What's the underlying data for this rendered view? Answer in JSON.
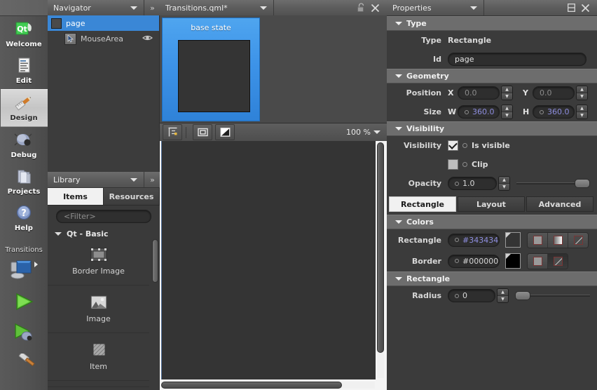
{
  "modebar": {
    "items": [
      {
        "label": "Welcome",
        "icon": "qt-logo-icon",
        "selected": false
      },
      {
        "label": "Edit",
        "icon": "document-edit-icon",
        "selected": false
      },
      {
        "label": "Design",
        "icon": "pencil-ruler-icon",
        "selected": true
      },
      {
        "label": "Debug",
        "icon": "bug-icon",
        "selected": false
      },
      {
        "label": "Projects",
        "icon": "folders-icon",
        "selected": false
      },
      {
        "label": "Help",
        "icon": "question-mark-icon",
        "selected": false
      }
    ],
    "target_label": "Transitions",
    "run_buttons": [
      {
        "name": "target-selector-icon"
      },
      {
        "name": "run-icon"
      },
      {
        "name": "debug-run-icon"
      },
      {
        "name": "build-hammer-icon"
      }
    ]
  },
  "navigator": {
    "title": "Navigator",
    "expand_label": "»",
    "rows": [
      {
        "label": "page",
        "selected": true,
        "has_eye": false,
        "icon": "rectangle-icon"
      },
      {
        "label": "MouseArea",
        "selected": false,
        "has_eye": true,
        "icon": "mousearea-cursor-icon"
      }
    ]
  },
  "library": {
    "title": "Library",
    "expand_label": "»",
    "tabs": [
      {
        "label": "Items",
        "active": true
      },
      {
        "label": "Resources",
        "active": false
      }
    ],
    "filter_placeholder": "<Filter>",
    "group": "Qt - Basic",
    "items": [
      {
        "label": "Border Image",
        "icon": "border-image-icon"
      },
      {
        "label": "Image",
        "icon": "image-icon"
      },
      {
        "label": "Item",
        "icon": "item-icon"
      }
    ]
  },
  "form_editor": {
    "document_title": "Transitions.qml*",
    "lock_icon": "unlocked-icon",
    "close_icon": "close-icon",
    "state_card": {
      "label": "base state"
    },
    "toolbar": {
      "buttons": [
        {
          "name": "anchors-icon"
        },
        {
          "name": "snap-to-item-icon"
        },
        {
          "name": "show-boundaries-icon"
        }
      ],
      "zoom_value": "100 %"
    }
  },
  "properties": {
    "title": "Properties",
    "split_icon": "split-icon",
    "close_icon": "close-icon",
    "sections": {
      "type": {
        "header": "Type",
        "type_label": "Type",
        "type_value": "Rectangle",
        "id_label": "Id",
        "id_value": "page"
      },
      "geometry": {
        "header": "Geometry",
        "position_label": "Position",
        "x_label": "X",
        "x_value": "0.0",
        "y_label": "Y",
        "y_value": "0.0",
        "size_label": "Size",
        "w_label": "W",
        "w_value": "360.0",
        "h_label": "H",
        "h_value": "360.0"
      },
      "visibility": {
        "header": "Visibility",
        "visibility_label": "Visibility",
        "is_visible_label": "Is visible",
        "is_visible_checked": true,
        "clip_label": "Clip",
        "clip_checked": false,
        "opacity_label": "Opacity",
        "opacity_value": "1.0"
      },
      "tabs": [
        {
          "label": "Rectangle",
          "active": true
        },
        {
          "label": "Layout",
          "active": false
        },
        {
          "label": "Advanced",
          "active": false
        }
      ],
      "colors": {
        "header": "Colors",
        "rectangle_label": "Rectangle",
        "rectangle_value": "#343434",
        "border_label": "Border",
        "border_value": "#000000",
        "fill_modes": [
          "solid-fill-icon",
          "gradient-fill-icon",
          "no-fill-icon"
        ],
        "border_modes": [
          "solid-fill-icon",
          "no-fill-icon"
        ]
      },
      "rectangle": {
        "header": "Rectangle",
        "radius_label": "Radius",
        "radius_value": "0"
      }
    }
  },
  "colors": {
    "selection_blue": "#3a87d6",
    "state_card_blue": "#3d93e8",
    "canvas_dark": "#343434",
    "panel_bg": "#3b3b3b",
    "section_header": "#6d6d6d",
    "numeric_violet": "#8e8ee0"
  }
}
